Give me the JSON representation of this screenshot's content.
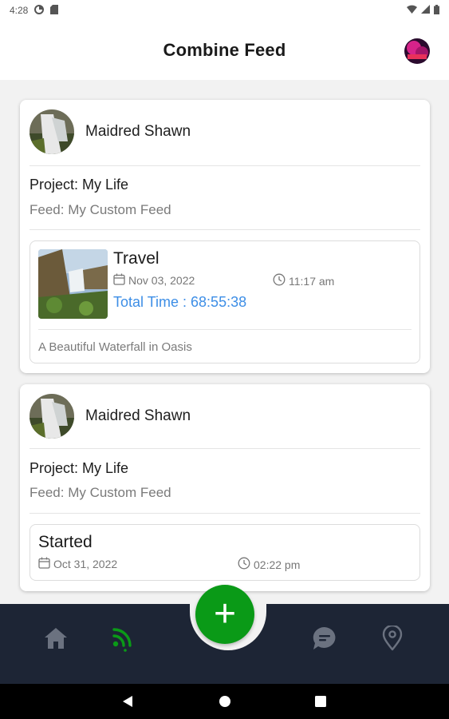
{
  "status_bar": {
    "time": "4:28"
  },
  "header": {
    "title": "Combine Feed"
  },
  "posts": [
    {
      "author": "Maidred Shawn",
      "project": "Project: My Life",
      "feed": "Feed: My Custom Feed",
      "entry": {
        "title": "Travel",
        "date": "Nov 03, 2022",
        "time": "11:17 am",
        "total_time": "Total Time : 68:55:38",
        "description": "A Beautiful Waterfall in Oasis"
      }
    },
    {
      "author": "Maidred Shawn",
      "project": "Project: My Life",
      "feed": "Feed: My Custom Feed",
      "entry": {
        "title": "Started",
        "date": "Oct 31, 2022",
        "time": "02:22 pm"
      }
    }
  ],
  "bottom_nav": {
    "items": [
      "home-icon",
      "rss-feed-icon",
      "add-icon",
      "chat-icon",
      "location-pin-icon"
    ],
    "fab_label": "+",
    "active_color": "#0a9a17",
    "inactive_color": "#6b7280"
  },
  "colors": {
    "accent_green": "#0a9a17",
    "link_blue": "#3d8ee6",
    "nav_bg": "#1d2535"
  }
}
